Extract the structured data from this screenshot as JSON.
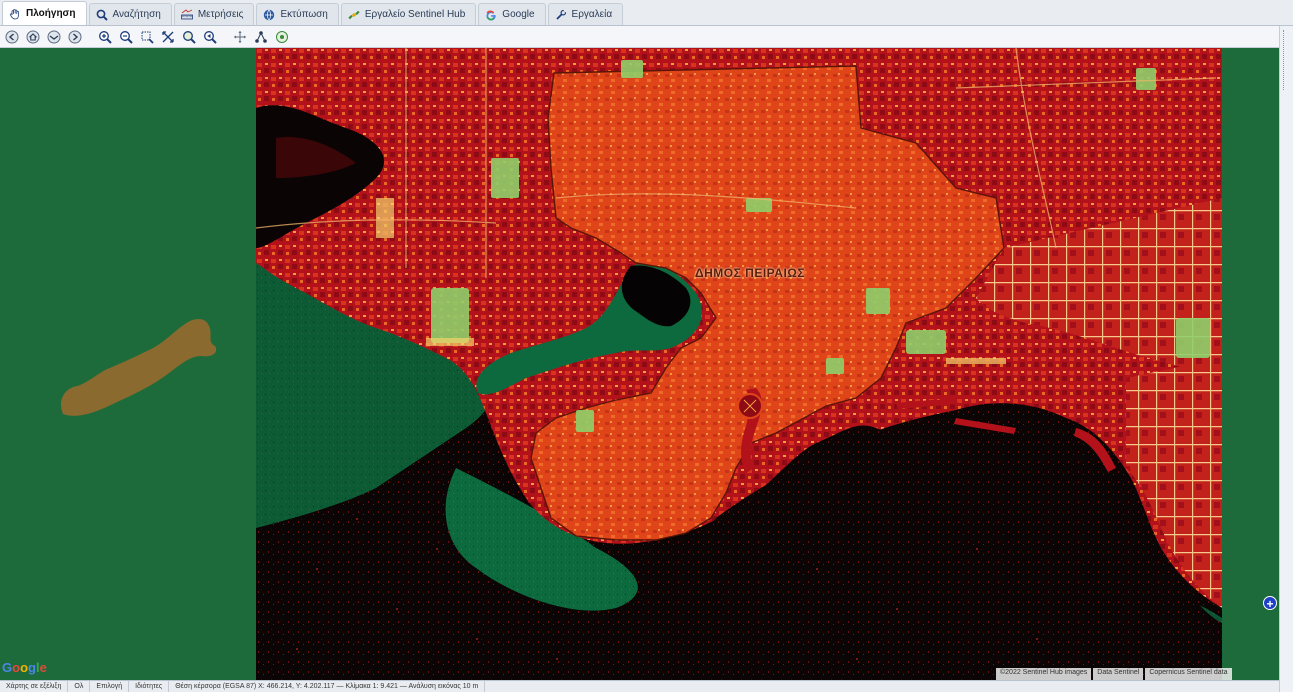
{
  "tabs": [
    {
      "label": "Πλοήγηση",
      "icon": "hand-pan-icon",
      "active": true
    },
    {
      "label": "Αναζήτηση",
      "icon": "magnifier-icon",
      "active": false
    },
    {
      "label": "Μετρήσεις",
      "icon": "ruler-measure-icon",
      "active": false
    },
    {
      "label": "Εκτύπωση",
      "icon": "globe-print-icon",
      "active": false
    },
    {
      "label": "Εργαλείο Sentinel Hub",
      "icon": "satellite-icon",
      "active": false
    },
    {
      "label": "Google",
      "icon": "google-g-icon",
      "active": false
    },
    {
      "label": "Εργαλεία",
      "icon": "tools-icon",
      "active": false
    }
  ],
  "toolbar": {
    "buttons": [
      "back-icon",
      "home-icon",
      "globe-icon",
      "forward-icon",
      "zoom-in-icon",
      "zoom-out-icon",
      "zoom-extent-icon",
      "full-extent-icon",
      "zoom-selection-icon",
      "zoom-previous-icon",
      "pan-icon",
      "network-icon",
      "refresh-icon"
    ]
  },
  "map": {
    "label": "ΔΗΜΟΣ ΠΕΙΡΑΙΩΣ",
    "google_logo": "Google",
    "attribution": [
      "©2022 Sentinel Hub images",
      "Data Sentinel",
      "Copernicus Sentinel data"
    ],
    "zoom_button": "+"
  },
  "statusbar": {
    "segments": [
      "Χάρτης σε εξέλιξη",
      "Ολ",
      "Επιλογή",
      "Ιδιότητες",
      "Θέση κέρσορα (EGSA 87) X: 466.214, Y: 4.202.117 — Κλίμακα 1: 9.421 — Ανάλυση εικόνας 10 m"
    ]
  },
  "colors": {
    "sea": "#1d6b3a",
    "urban_red": "#b3121a",
    "municipality_orange": "#e0451a",
    "vegetation": "#8fcf6a"
  }
}
